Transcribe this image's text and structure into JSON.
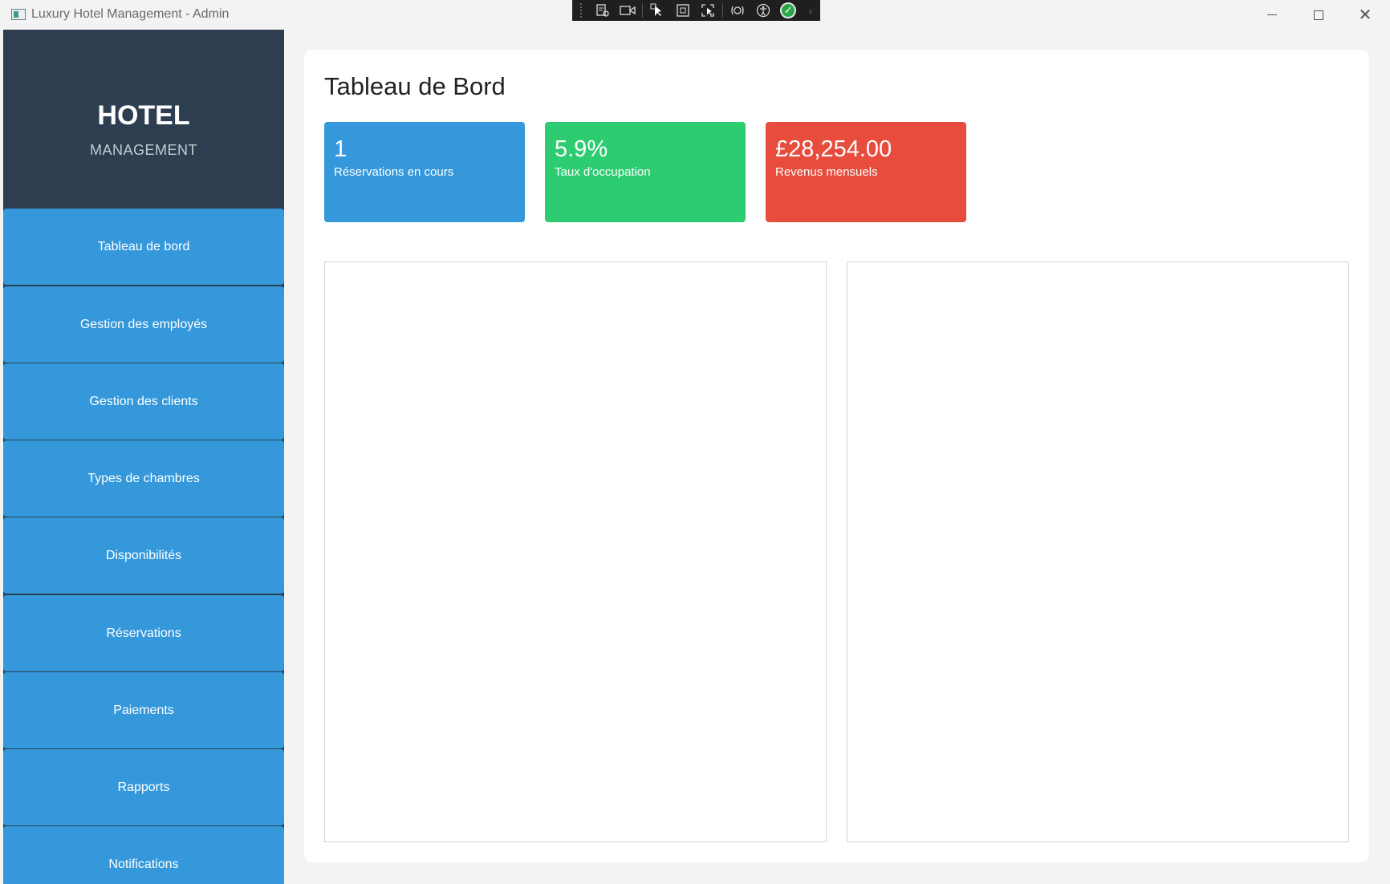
{
  "window": {
    "title": "Luxury Hotel Management - Admin",
    "minimize_icon": "minimize-icon",
    "maximize_icon": "maximize-icon",
    "close_glyph": "✕"
  },
  "debug_toolbar": {
    "icons": [
      "live-visual-tree-icon",
      "record-icon",
      "select-element-icon",
      "display-layout-adorners-icon",
      "track-focused-element-icon",
      "binding-failures-icon",
      "accessibility-icon",
      "hot-reload-ok-icon",
      "collapse-chevron-icon"
    ]
  },
  "sidebar": {
    "brand_title": "HOTEL",
    "brand_subtitle": "MANAGEMENT",
    "items": [
      {
        "label": "Tableau de bord"
      },
      {
        "label": "Gestion des employés"
      },
      {
        "label": "Gestion des clients"
      },
      {
        "label": "Types de chambres"
      },
      {
        "label": "Disponibilités"
      },
      {
        "label": "Réservations"
      },
      {
        "label": "Paiements"
      },
      {
        "label": "Rapports"
      },
      {
        "label": "Notifications"
      }
    ]
  },
  "main": {
    "title": "Tableau de Bord",
    "stats": [
      {
        "value": "1",
        "label": "Réservations en cours",
        "color": "#3498db"
      },
      {
        "value": "5.9%",
        "label": "Taux d'occupation",
        "color": "#2ecc71"
      },
      {
        "value": "£28,254.00",
        "label": "Revenus mensuels",
        "color": "#e74c3c"
      }
    ]
  },
  "colors": {
    "sidebar_bg": "#2c3e50",
    "nav_button": "#3498db",
    "page_bg": "#f3f3f3"
  }
}
